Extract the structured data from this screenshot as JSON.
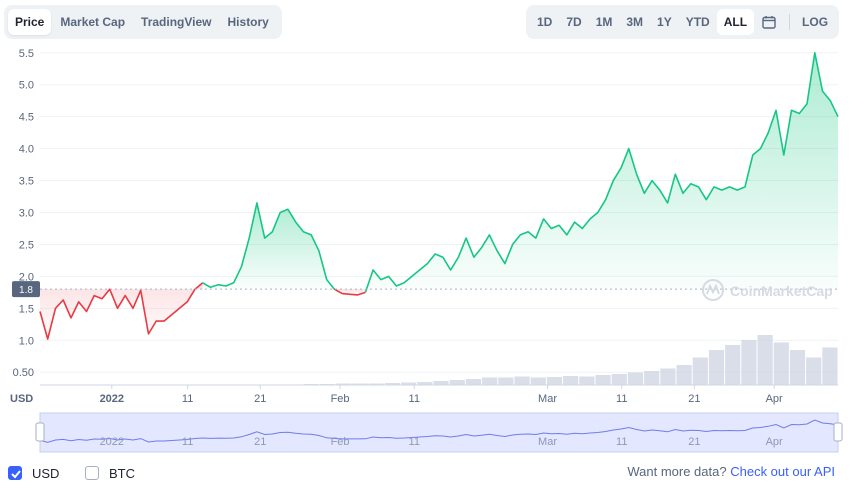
{
  "tabs": [
    {
      "label": "Price",
      "active": true
    },
    {
      "label": "Market Cap",
      "active": false
    },
    {
      "label": "TradingView",
      "active": false
    },
    {
      "label": "History",
      "active": false
    }
  ],
  "ranges": [
    {
      "label": "1D",
      "active": false
    },
    {
      "label": "7D",
      "active": false
    },
    {
      "label": "1M",
      "active": false
    },
    {
      "label": "3M",
      "active": false
    },
    {
      "label": "1Y",
      "active": false
    },
    {
      "label": "YTD",
      "active": false
    },
    {
      "label": "ALL",
      "active": true
    }
  ],
  "calendar_icon": "calendar-icon",
  "log_label": "LOG",
  "currency_unit": "USD",
  "watermark": "CoinMarketCap",
  "colors": {
    "up": "#16c784",
    "down": "#ea3943",
    "accent": "#3861fb",
    "nav_fill": "#e3e7ff"
  },
  "footer": {
    "usd_label": "USD",
    "usd_checked": true,
    "btc_label": "BTC",
    "btc_checked": false,
    "api_text": "Want more data?",
    "api_link": "Check out our API"
  },
  "chart_data": {
    "type": "area",
    "ylim": [
      0.3,
      5.7
    ],
    "y_ticks": [
      "0.50",
      "1.0",
      "1.5",
      "2.0",
      "2.5",
      "3.0",
      "3.5",
      "4.0",
      "4.5",
      "5.0",
      "5.5"
    ],
    "x_ticks": [
      "2022",
      "11",
      "21",
      "Feb",
      "11",
      "Mar",
      "11",
      "21",
      "Apr"
    ],
    "reference_price": 1.8,
    "reference_label": "1.8",
    "series": [
      {
        "values": [
          1.45,
          1.02,
          1.5,
          1.63,
          1.35,
          1.6,
          1.45,
          1.7,
          1.65,
          1.8,
          1.5,
          1.7,
          1.5,
          1.78,
          1.1,
          1.3,
          1.3,
          1.4,
          1.5,
          1.6,
          1.8,
          1.9
        ]
      },
      {
        "values": [
          1.9,
          1.83,
          1.87,
          1.85,
          1.9,
          2.15,
          2.6,
          3.15,
          2.6,
          2.7,
          3.0,
          3.05,
          2.85,
          2.7,
          2.65,
          2.4,
          1.95,
          1.8
        ]
      },
      {
        "values": [
          1.8,
          1.73,
          1.72,
          1.71,
          1.75
        ]
      },
      {
        "values": [
          1.75,
          2.1,
          1.95,
          2.0,
          1.85,
          1.9,
          2.0,
          2.1,
          2.2,
          2.35,
          2.3,
          2.1,
          2.3,
          2.6,
          2.3,
          2.45,
          2.65,
          2.4,
          2.2,
          2.5,
          2.65,
          2.7,
          2.6,
          2.9,
          2.75,
          2.8,
          2.65,
          2.85,
          2.75,
          2.9,
          3.0,
          3.2,
          3.5,
          3.7,
          4.0,
          3.6,
          3.3,
          3.5,
          3.35,
          3.15,
          3.6,
          3.3,
          3.45,
          3.4,
          3.2,
          3.4,
          3.35,
          3.4,
          3.35,
          3.4,
          3.9,
          4.0,
          4.25,
          4.6,
          3.9,
          4.6,
          4.55,
          4.7,
          5.5,
          4.9,
          4.75,
          4.5
        ]
      }
    ],
    "volume": [
      0.02,
      0.02,
      0.03,
      0.03,
      0.03,
      0.04,
      0.05,
      0.06,
      0.08,
      0.1,
      0.12,
      0.15,
      0.15,
      0.17,
      0.15,
      0.16,
      0.18,
      0.17,
      0.2,
      0.22,
      0.25,
      0.28,
      0.33,
      0.4,
      0.55,
      0.7,
      0.8,
      0.9,
      1.0,
      0.85,
      0.7,
      0.55,
      0.75
    ]
  }
}
